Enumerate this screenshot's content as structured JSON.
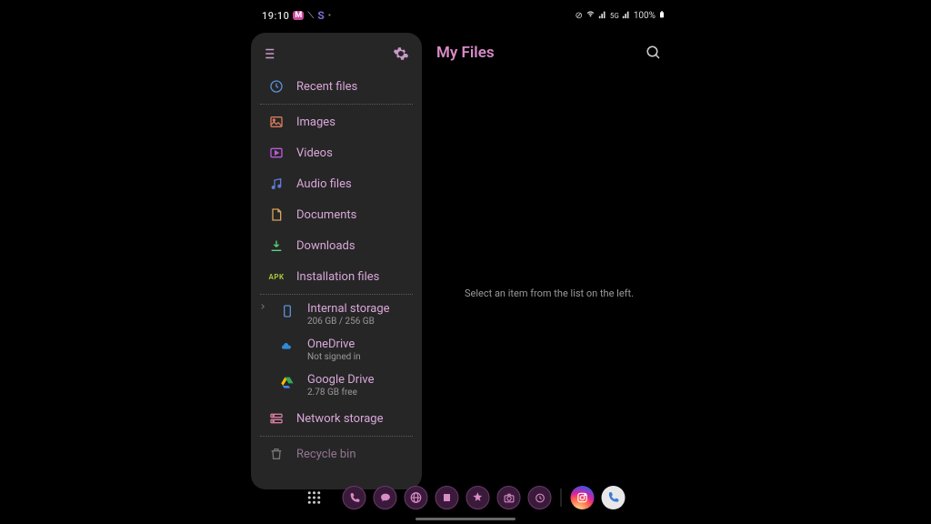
{
  "status": {
    "time": "19:10",
    "battery": "100%"
  },
  "header": {
    "title": "My Files"
  },
  "main": {
    "empty": "Select an item from the list on the left."
  },
  "sidebar": {
    "categories": [
      {
        "label": "Recent files"
      },
      {
        "label": "Images"
      },
      {
        "label": "Videos"
      },
      {
        "label": "Audio files"
      },
      {
        "label": "Documents"
      },
      {
        "label": "Downloads"
      },
      {
        "label": "Installation files"
      }
    ],
    "storage": [
      {
        "title": "Internal storage",
        "sub": "206 GB / 256 GB"
      },
      {
        "title": "OneDrive",
        "sub": "Not signed in"
      },
      {
        "title": "Google Drive",
        "sub": "2.78 GB free"
      },
      {
        "title": "Network storage",
        "sub": ""
      }
    ],
    "trash": {
      "title": "Recycle bin"
    }
  }
}
